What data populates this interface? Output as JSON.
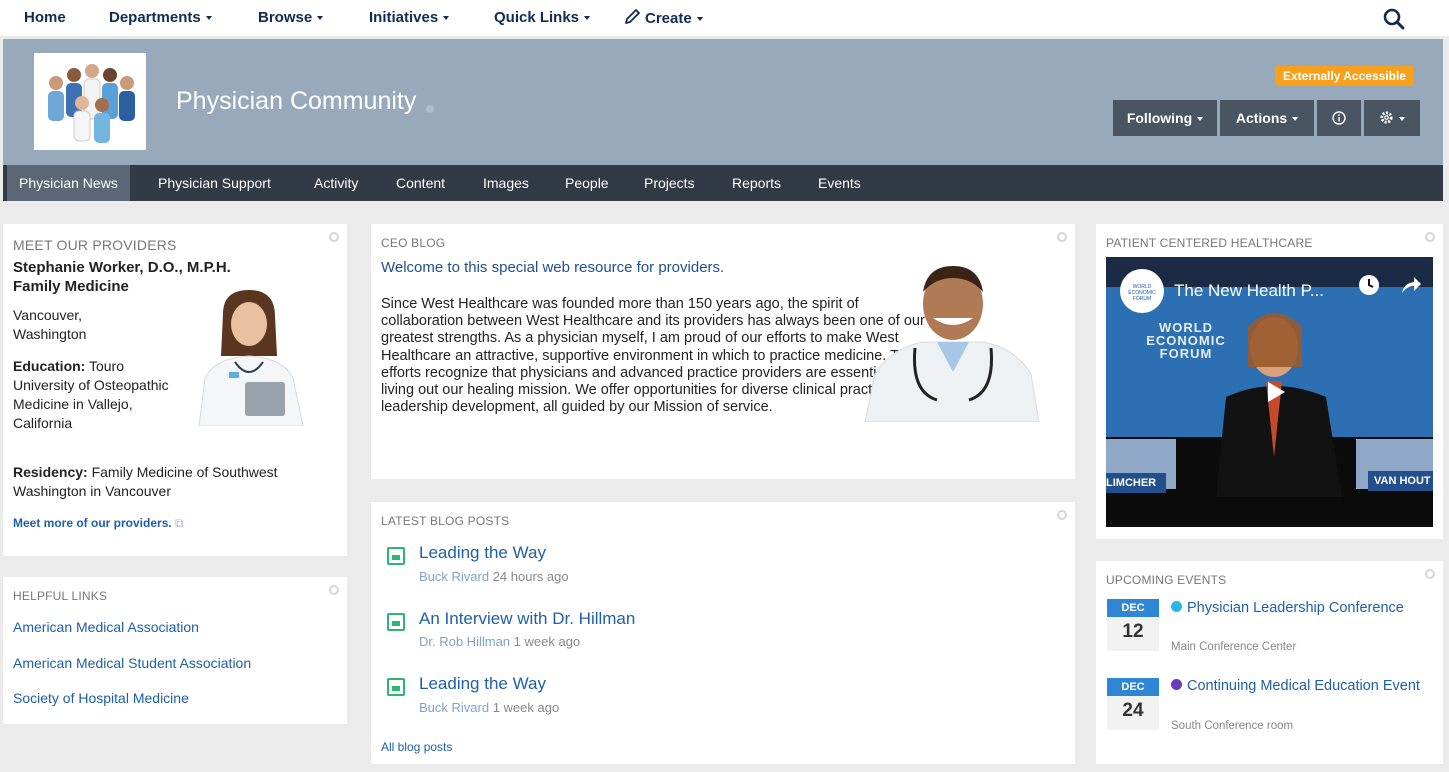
{
  "topnav": {
    "home": "Home",
    "departments": "Departments",
    "browse": "Browse",
    "initiatives": "Initiatives",
    "quick_links": "Quick Links",
    "create": "Create"
  },
  "banner": {
    "title": "Physician Community",
    "badge": "Externally Accessible",
    "buttons": {
      "following": "Following",
      "actions": "Actions"
    }
  },
  "subnav": {
    "tabs": [
      {
        "label": "Physician News",
        "active": true
      },
      {
        "label": "Physician Support"
      },
      {
        "label": "Activity"
      },
      {
        "label": "Content"
      },
      {
        "label": "Images"
      },
      {
        "label": "People"
      },
      {
        "label": "Projects"
      },
      {
        "label": "Reports"
      },
      {
        "label": "Events"
      }
    ]
  },
  "providers": {
    "title": "MEET OUR PROVIDERS",
    "name": "Stephanie Worker, D.O., M.P.H.",
    "specialty": "Family Medicine",
    "location": "Vancouver, Washington",
    "education_label": "Education:",
    "education": "Touro University of Osteopathic Medicine in Vallejo, California",
    "residency_label": "Residency:",
    "residency": "Family Medicine of Southwest Washington in Vancouver",
    "more_link": "Meet more of our providers."
  },
  "helpful_links": {
    "title": "HELPFUL LINKS",
    "links": [
      "American Medical Association",
      "American Medical Student Association",
      "Society of Hospital Medicine"
    ]
  },
  "ceo_blog": {
    "title": "CEO BLOG",
    "headline": "Welcome to this special web resource for providers.",
    "body": "Since West Healthcare was founded more than 150 years ago, the spirit of collaboration between West Healthcare and its providers has always been one of our greatest strengths. As a physician myself, I am proud of our efforts to make West Healthcare an attractive, supportive environment in which to practice medicine. These efforts recognize that physicians and advanced practice providers are essential to living out our healing mission. We offer opportunities for diverse clinical practices and leadership development, all guided by our Mission of service."
  },
  "blog_posts": {
    "title": "LATEST BLOG POSTS",
    "posts": [
      {
        "title": "Leading the Way",
        "author": "Buck Rivard",
        "time": "24 hours ago"
      },
      {
        "title": "An Interview with Dr. Hillman",
        "author": "Dr. Rob Hillman",
        "time": "1 week ago"
      },
      {
        "title": "Leading the Way",
        "author": "Buck Rivard",
        "time": "1 week ago"
      }
    ],
    "all_link": "All blog posts"
  },
  "video": {
    "title": "PATIENT CENTERED HEALTHCARE",
    "video_title": "The New Health P...",
    "channel_logo": "WORLD ECONOMIC FORUM",
    "watermark": "WORLD ECONOMIC FORUM",
    "name_left": "LIMCHER",
    "name_right": "VAN HOUT"
  },
  "events": {
    "title": "UPCOMING EVENTS",
    "items": [
      {
        "month": "DEC",
        "day": "12",
        "name": "Physician Leadership Conference",
        "place": "Main Conference Center",
        "color": "#29b6e8"
      },
      {
        "month": "DEC",
        "day": "24",
        "name": "Continuing Medical Education Event",
        "place": "South Conference room",
        "color": "#6a3bbf"
      }
    ]
  }
}
